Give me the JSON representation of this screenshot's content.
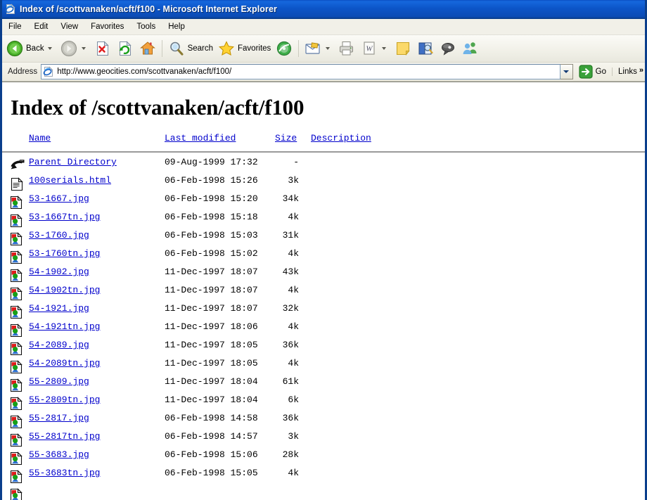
{
  "window": {
    "title": "Index of /scottvanaken/acft/f100 - Microsoft Internet Explorer",
    "title_icon": "ie-document-icon",
    "titlebar_color": "#0c55c8"
  },
  "menu": {
    "items": [
      {
        "label": "File"
      },
      {
        "label": "Edit"
      },
      {
        "label": "View"
      },
      {
        "label": "Favorites"
      },
      {
        "label": "Tools"
      },
      {
        "label": "Help"
      }
    ]
  },
  "toolbar": {
    "back_label": "Back",
    "search_label": "Search",
    "favorites_label": "Favorites",
    "icons": [
      "back-arrow-icon",
      "forward-arrow-icon",
      "stop-icon",
      "refresh-icon",
      "home-icon",
      "search-icon",
      "favorites-star-icon",
      "media-icon",
      "mail-icon",
      "print-icon",
      "edit-word-icon",
      "notes-icon",
      "research-icon",
      "discuss-icon",
      "messenger-icon"
    ]
  },
  "address": {
    "label": "Address",
    "url": "http://www.geocities.com/scottvanaken/acft/f100/",
    "placeholder": "http://",
    "go_label": "Go",
    "links_label": "Links",
    "overflow": "»"
  },
  "page": {
    "heading": "Index of /scottvanaken/acft/f100",
    "columns": {
      "name": "Name",
      "last_modified": "Last modified",
      "size": "Size",
      "description": "Description"
    },
    "link_color": "#0000cc",
    "rows": [
      {
        "icon": "parent-directory-icon",
        "name": "Parent Directory",
        "last_modified": "09-Aug-1999 17:32",
        "size": "-",
        "description": ""
      },
      {
        "icon": "html-document-icon",
        "name": "100serials.html",
        "last_modified": "06-Feb-1998 15:26",
        "size": "3k",
        "description": ""
      },
      {
        "icon": "image-file-icon",
        "name": "53-1667.jpg",
        "last_modified": "06-Feb-1998 15:20",
        "size": "34k",
        "description": ""
      },
      {
        "icon": "image-file-icon",
        "name": "53-1667tn.jpg",
        "last_modified": "06-Feb-1998 15:18",
        "size": "4k",
        "description": ""
      },
      {
        "icon": "image-file-icon",
        "name": "53-1760.jpg",
        "last_modified": "06-Feb-1998 15:03",
        "size": "31k",
        "description": ""
      },
      {
        "icon": "image-file-icon",
        "name": "53-1760tn.jpg",
        "last_modified": "06-Feb-1998 15:02",
        "size": "4k",
        "description": ""
      },
      {
        "icon": "image-file-icon",
        "name": "54-1902.jpg",
        "last_modified": "11-Dec-1997 18:07",
        "size": "43k",
        "description": ""
      },
      {
        "icon": "image-file-icon",
        "name": "54-1902tn.jpg",
        "last_modified": "11-Dec-1997 18:07",
        "size": "4k",
        "description": ""
      },
      {
        "icon": "image-file-icon",
        "name": "54-1921.jpg",
        "last_modified": "11-Dec-1997 18:07",
        "size": "32k",
        "description": ""
      },
      {
        "icon": "image-file-icon",
        "name": "54-1921tn.jpg",
        "last_modified": "11-Dec-1997 18:06",
        "size": "4k",
        "description": ""
      },
      {
        "icon": "image-file-icon",
        "name": "54-2089.jpg",
        "last_modified": "11-Dec-1997 18:05",
        "size": "36k",
        "description": ""
      },
      {
        "icon": "image-file-icon",
        "name": "54-2089tn.jpg",
        "last_modified": "11-Dec-1997 18:05",
        "size": "4k",
        "description": ""
      },
      {
        "icon": "image-file-icon",
        "name": "55-2809.jpg",
        "last_modified": "11-Dec-1997 18:04",
        "size": "61k",
        "description": ""
      },
      {
        "icon": "image-file-icon",
        "name": "55-2809tn.jpg",
        "last_modified": "11-Dec-1997 18:04",
        "size": "6k",
        "description": ""
      },
      {
        "icon": "image-file-icon",
        "name": "55-2817.jpg",
        "last_modified": "06-Feb-1998 14:58",
        "size": "36k",
        "description": ""
      },
      {
        "icon": "image-file-icon",
        "name": "55-2817tn.jpg",
        "last_modified": "06-Feb-1998 14:57",
        "size": "3k",
        "description": ""
      },
      {
        "icon": "image-file-icon",
        "name": "55-3683.jpg",
        "last_modified": "06-Feb-1998 15:06",
        "size": "28k",
        "description": ""
      },
      {
        "icon": "image-file-icon",
        "name": "55-3683tn.jpg",
        "last_modified": "06-Feb-1998 15:05",
        "size": "4k",
        "description": ""
      },
      {
        "icon": "image-file-icon",
        "name": "",
        "last_modified": "",
        "size": "",
        "description": ""
      }
    ]
  }
}
